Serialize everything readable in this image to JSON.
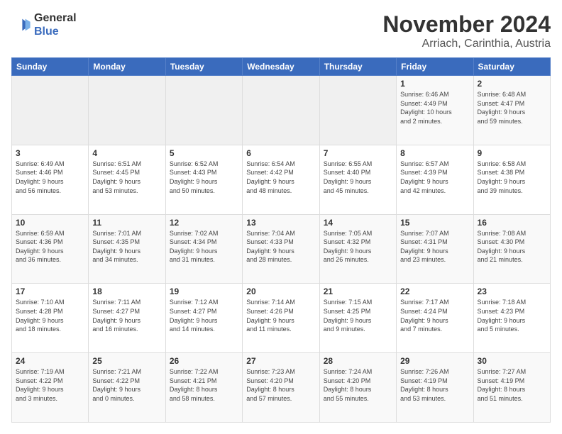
{
  "logo": {
    "line1": "General",
    "line2": "Blue"
  },
  "title": "November 2024",
  "location": "Arriach, Carinthia, Austria",
  "weekdays": [
    "Sunday",
    "Monday",
    "Tuesday",
    "Wednesday",
    "Thursday",
    "Friday",
    "Saturday"
  ],
  "rows": [
    [
      {
        "day": "",
        "info": ""
      },
      {
        "day": "",
        "info": ""
      },
      {
        "day": "",
        "info": ""
      },
      {
        "day": "",
        "info": ""
      },
      {
        "day": "",
        "info": ""
      },
      {
        "day": "1",
        "info": "Sunrise: 6:46 AM\nSunset: 4:49 PM\nDaylight: 10 hours\nand 2 minutes."
      },
      {
        "day": "2",
        "info": "Sunrise: 6:48 AM\nSunset: 4:47 PM\nDaylight: 9 hours\nand 59 minutes."
      }
    ],
    [
      {
        "day": "3",
        "info": "Sunrise: 6:49 AM\nSunset: 4:46 PM\nDaylight: 9 hours\nand 56 minutes."
      },
      {
        "day": "4",
        "info": "Sunrise: 6:51 AM\nSunset: 4:45 PM\nDaylight: 9 hours\nand 53 minutes."
      },
      {
        "day": "5",
        "info": "Sunrise: 6:52 AM\nSunset: 4:43 PM\nDaylight: 9 hours\nand 50 minutes."
      },
      {
        "day": "6",
        "info": "Sunrise: 6:54 AM\nSunset: 4:42 PM\nDaylight: 9 hours\nand 48 minutes."
      },
      {
        "day": "7",
        "info": "Sunrise: 6:55 AM\nSunset: 4:40 PM\nDaylight: 9 hours\nand 45 minutes."
      },
      {
        "day": "8",
        "info": "Sunrise: 6:57 AM\nSunset: 4:39 PM\nDaylight: 9 hours\nand 42 minutes."
      },
      {
        "day": "9",
        "info": "Sunrise: 6:58 AM\nSunset: 4:38 PM\nDaylight: 9 hours\nand 39 minutes."
      }
    ],
    [
      {
        "day": "10",
        "info": "Sunrise: 6:59 AM\nSunset: 4:36 PM\nDaylight: 9 hours\nand 36 minutes."
      },
      {
        "day": "11",
        "info": "Sunrise: 7:01 AM\nSunset: 4:35 PM\nDaylight: 9 hours\nand 34 minutes."
      },
      {
        "day": "12",
        "info": "Sunrise: 7:02 AM\nSunset: 4:34 PM\nDaylight: 9 hours\nand 31 minutes."
      },
      {
        "day": "13",
        "info": "Sunrise: 7:04 AM\nSunset: 4:33 PM\nDaylight: 9 hours\nand 28 minutes."
      },
      {
        "day": "14",
        "info": "Sunrise: 7:05 AM\nSunset: 4:32 PM\nDaylight: 9 hours\nand 26 minutes."
      },
      {
        "day": "15",
        "info": "Sunrise: 7:07 AM\nSunset: 4:31 PM\nDaylight: 9 hours\nand 23 minutes."
      },
      {
        "day": "16",
        "info": "Sunrise: 7:08 AM\nSunset: 4:30 PM\nDaylight: 9 hours\nand 21 minutes."
      }
    ],
    [
      {
        "day": "17",
        "info": "Sunrise: 7:10 AM\nSunset: 4:28 PM\nDaylight: 9 hours\nand 18 minutes."
      },
      {
        "day": "18",
        "info": "Sunrise: 7:11 AM\nSunset: 4:27 PM\nDaylight: 9 hours\nand 16 minutes."
      },
      {
        "day": "19",
        "info": "Sunrise: 7:12 AM\nSunset: 4:27 PM\nDaylight: 9 hours\nand 14 minutes."
      },
      {
        "day": "20",
        "info": "Sunrise: 7:14 AM\nSunset: 4:26 PM\nDaylight: 9 hours\nand 11 minutes."
      },
      {
        "day": "21",
        "info": "Sunrise: 7:15 AM\nSunset: 4:25 PM\nDaylight: 9 hours\nand 9 minutes."
      },
      {
        "day": "22",
        "info": "Sunrise: 7:17 AM\nSunset: 4:24 PM\nDaylight: 9 hours\nand 7 minutes."
      },
      {
        "day": "23",
        "info": "Sunrise: 7:18 AM\nSunset: 4:23 PM\nDaylight: 9 hours\nand 5 minutes."
      }
    ],
    [
      {
        "day": "24",
        "info": "Sunrise: 7:19 AM\nSunset: 4:22 PM\nDaylight: 9 hours\nand 3 minutes."
      },
      {
        "day": "25",
        "info": "Sunrise: 7:21 AM\nSunset: 4:22 PM\nDaylight: 9 hours\nand 0 minutes."
      },
      {
        "day": "26",
        "info": "Sunrise: 7:22 AM\nSunset: 4:21 PM\nDaylight: 8 hours\nand 58 minutes."
      },
      {
        "day": "27",
        "info": "Sunrise: 7:23 AM\nSunset: 4:20 PM\nDaylight: 8 hours\nand 57 minutes."
      },
      {
        "day": "28",
        "info": "Sunrise: 7:24 AM\nSunset: 4:20 PM\nDaylight: 8 hours\nand 55 minutes."
      },
      {
        "day": "29",
        "info": "Sunrise: 7:26 AM\nSunset: 4:19 PM\nDaylight: 8 hours\nand 53 minutes."
      },
      {
        "day": "30",
        "info": "Sunrise: 7:27 AM\nSunset: 4:19 PM\nDaylight: 8 hours\nand 51 minutes."
      }
    ]
  ]
}
